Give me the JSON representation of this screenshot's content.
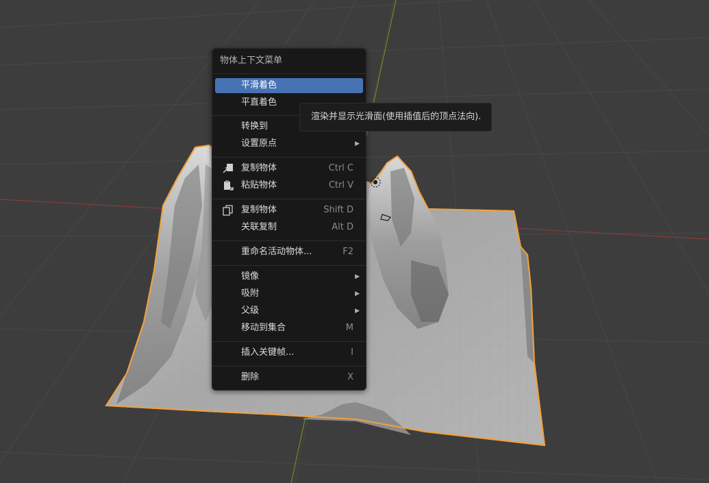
{
  "menu": {
    "title": "物体上下文菜单",
    "items": [
      {
        "label": "平滑着色",
        "shortcut": "",
        "submenu": false,
        "active": true
      },
      {
        "label": "平直着色",
        "shortcut": "",
        "submenu": false
      },
      {
        "label": "转换到",
        "shortcut": "",
        "submenu": false
      },
      {
        "label": "设置原点",
        "shortcut": "",
        "submenu": true
      },
      {
        "label": "复制物体",
        "shortcut": "Ctrl C",
        "submenu": false,
        "icon": "copy-to-buffer-icon"
      },
      {
        "label": "粘贴物体",
        "shortcut": "Ctrl V",
        "submenu": false,
        "icon": "paste-from-buffer-icon"
      },
      {
        "label": "复制物体",
        "shortcut": "Shift D",
        "submenu": false,
        "icon": "duplicate-icon"
      },
      {
        "label": "关联复制",
        "shortcut": "Alt D",
        "submenu": false
      },
      {
        "label": "重命名活动物体...",
        "shortcut": "F2",
        "submenu": false
      },
      {
        "label": "镜像",
        "shortcut": "",
        "submenu": true
      },
      {
        "label": "吸附",
        "shortcut": "",
        "submenu": true
      },
      {
        "label": "父级",
        "shortcut": "",
        "submenu": true
      },
      {
        "label": "移动到集合",
        "shortcut": "M",
        "submenu": false
      },
      {
        "label": "插入关键帧...",
        "shortcut": "I",
        "submenu": false
      },
      {
        "label": "删除",
        "shortcut": "X",
        "submenu": false
      }
    ],
    "submenu_arrow": "▶"
  },
  "tooltip": {
    "text": "渲染并显示光滑面(使用插值后的顶点法向)."
  },
  "colors": {
    "viewport_bg": "#3d3d3d",
    "grid": "#4a4a4a",
    "x_axis": "#8b3a3a",
    "y_axis": "#6b8e23",
    "selection_outline": "#f0a040",
    "menu_bg": "#181818",
    "highlight": "#4772b3"
  }
}
